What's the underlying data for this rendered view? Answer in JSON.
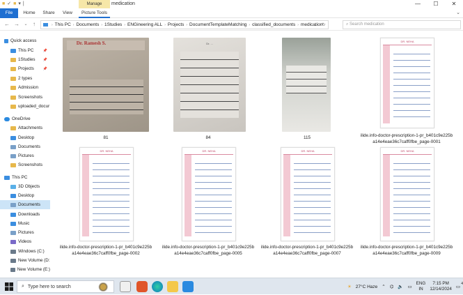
{
  "window": {
    "title": "medication",
    "manage_tab": "Manage",
    "minimize": "—",
    "maximize": "☐",
    "close": "✕"
  },
  "ribbon": {
    "tabs": [
      "File",
      "Home",
      "Share",
      "View",
      "Picture Tools"
    ]
  },
  "address": {
    "crumbs": [
      "This PC",
      "Documents",
      "1Studies",
      "ENGineering ALL",
      "Projects",
      "DocumentTemplateMatching",
      "classified_documents",
      "medication"
    ],
    "search_placeholder": "Search medication"
  },
  "sidebar": {
    "items": [
      {
        "label": "Quick access",
        "color": "#3b8ee0",
        "pinned": false
      },
      {
        "label": "This PC",
        "color": "#3b8ee0",
        "pinned": true
      },
      {
        "label": "1Studies",
        "color": "#e7b84b",
        "pinned": true
      },
      {
        "label": "Projects",
        "color": "#e7b84b",
        "pinned": true
      },
      {
        "label": "2 types",
        "color": "#e7b84b",
        "pinned": false
      },
      {
        "label": "Admission",
        "color": "#e7b84b",
        "pinned": false
      },
      {
        "label": "Screenshots",
        "color": "#e7b84b",
        "pinned": false
      },
      {
        "label": "uploaded_docur",
        "color": "#e7b84b",
        "pinned": false
      },
      {
        "label": "OneDrive",
        "color": "#2a8ae0",
        "pinned": false
      },
      {
        "label": "Attachments",
        "color": "#e7b84b",
        "pinned": false
      },
      {
        "label": "Desktop",
        "color": "#3b8ee0",
        "pinned": false
      },
      {
        "label": "Documents",
        "color": "#7aa0c8",
        "pinned": false
      },
      {
        "label": "Pictures",
        "color": "#7aa0c8",
        "pinned": false
      },
      {
        "label": "Screenshots",
        "color": "#e7b84b",
        "pinned": false
      },
      {
        "label": "This PC",
        "color": "#3b8ee0",
        "pinned": false
      },
      {
        "label": "3D Objects",
        "color": "#5ab0e8",
        "pinned": false
      },
      {
        "label": "Desktop",
        "color": "#3b8ee0",
        "pinned": false
      },
      {
        "label": "Documents",
        "color": "#7aa0c8",
        "pinned": false,
        "selected": true
      },
      {
        "label": "Downloads",
        "color": "#3b8ee0",
        "pinned": false
      },
      {
        "label": "Music",
        "color": "#3b8ee0",
        "pinned": false
      },
      {
        "label": "Pictures",
        "color": "#7aa0c8",
        "pinned": false
      },
      {
        "label": "Videos",
        "color": "#7a6ac8",
        "pinned": false
      },
      {
        "label": "Windows (C:)",
        "color": "#6a7a8a",
        "pinned": false
      },
      {
        "label": "New Volume (D:",
        "color": "#6a7a8a",
        "pinned": false
      },
      {
        "label": "New Volume (E:)",
        "color": "#6a7a8a",
        "pinned": false
      }
    ]
  },
  "files": [
    {
      "name": "81",
      "kind": "photo-prescription"
    },
    {
      "name": "84",
      "kind": "photo-note"
    },
    {
      "name": "115",
      "kind": "photo-small"
    },
    {
      "name": "ilide.info-doctor-prescription-1-pr_b401c9e225b a14e4eae36c7caff0fbe_page-0001",
      "kind": "doc"
    },
    {
      "name": "ilide.info-doctor-prescription-1-pr_b401c9e225b a14e4eae36c7caff0fbe_page-0002",
      "kind": "doc"
    },
    {
      "name": "ilide.info-doctor-prescription-1-pr_b401c9e225b a14e4eae36c7caff0fbe_page-0005",
      "kind": "doc"
    },
    {
      "name": "ilide.info-doctor-prescription-1-pr_b401c9e225b a14e4eae36c7caff0fbe_page-0007",
      "kind": "doc"
    },
    {
      "name": "ilide.info-doctor-prescription-1-pr_b401c9e225b a14e4eae36c7caff0fbe_page-0009",
      "kind": "doc"
    }
  ],
  "taskbar": {
    "search_text": "Type here to search",
    "weather": "27°C Haze",
    "lang1": "ENG",
    "lang2": "IN",
    "time": "7:15 PM",
    "date": "12/14/2024",
    "notifications": "4"
  }
}
